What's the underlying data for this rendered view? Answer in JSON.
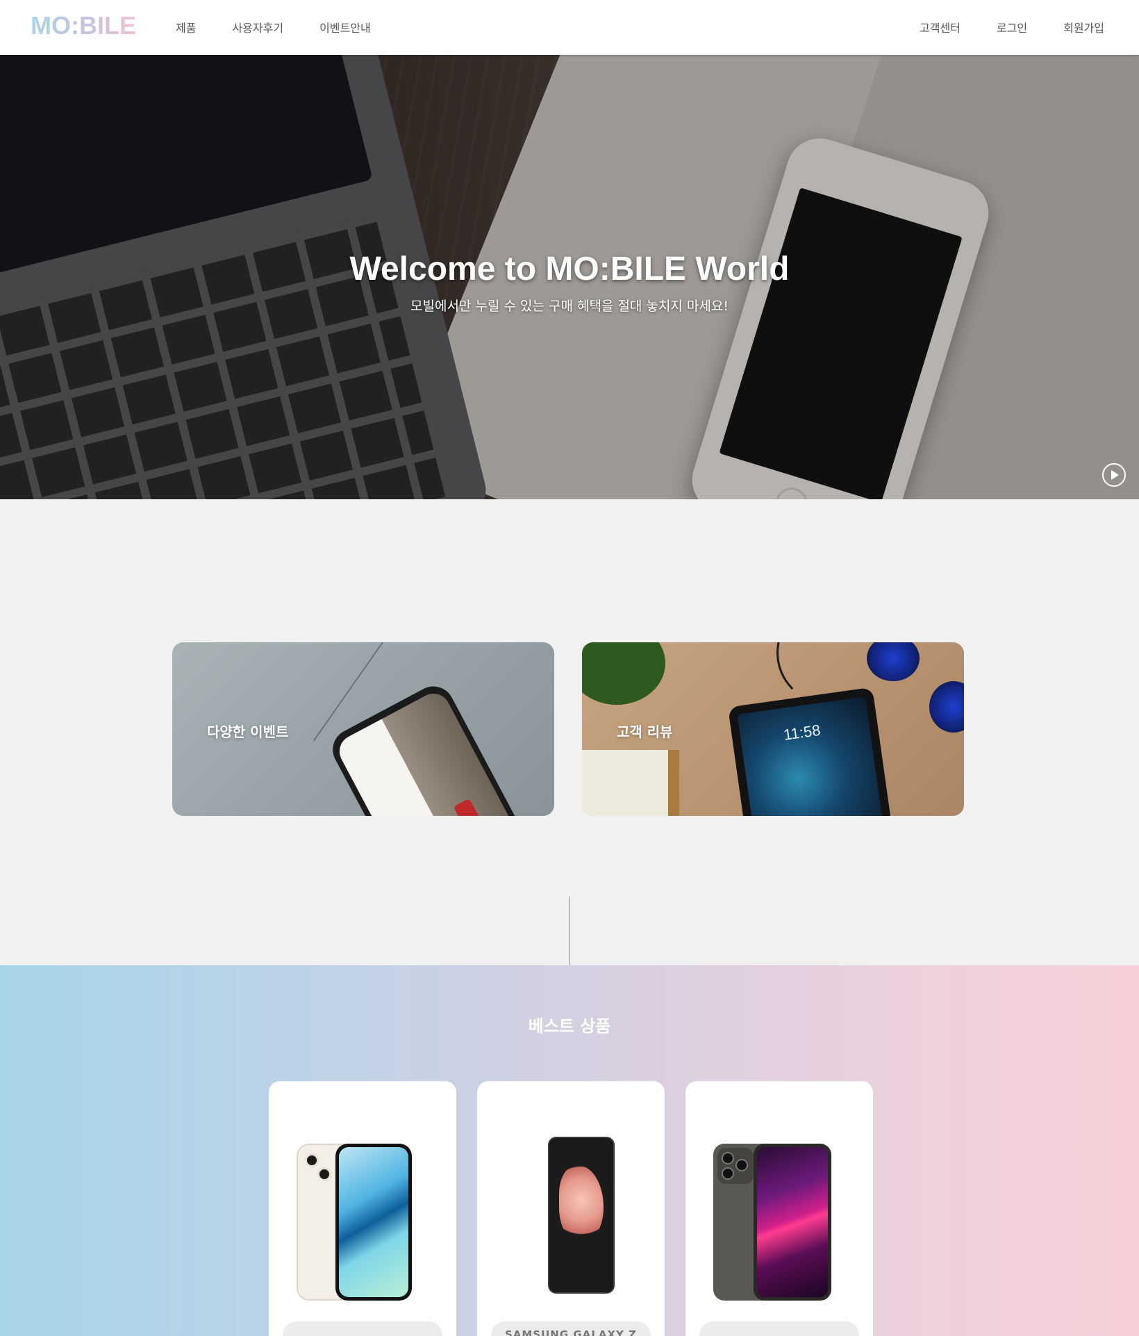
{
  "header": {
    "logo": "MO:BILE",
    "nav_left": [
      "제품",
      "사용자후기",
      "이벤트안내"
    ],
    "nav_right": [
      "고객센터",
      "로그인",
      "회원가입"
    ]
  },
  "hero": {
    "title": "Welcome to MO:BILE World",
    "subtitle": "모빌에서만 누릴 수 있는 구매 혜택을 절대 놓치지 마세요!",
    "play_icon": "play-circle-icon"
  },
  "categories": [
    {
      "label": "다양한 이벤트"
    },
    {
      "label": "고객 리뷰",
      "tablet_time": "11:58"
    }
  ],
  "best": {
    "title": "베스트 상품",
    "products": [
      {
        "image": "iphone-13-image",
        "name": ""
      },
      {
        "image": "galaxy-z-flip3-image",
        "name": "SAMSUNG GALAXY Z"
      },
      {
        "image": "iphone-13-pro-image",
        "name": ""
      }
    ]
  },
  "colors": {
    "gradient_left": "#a6d5ea",
    "gradient_right": "#f7cfd8",
    "logo_gradient": [
      "#a8d4ea",
      "#f2c3d3"
    ]
  }
}
